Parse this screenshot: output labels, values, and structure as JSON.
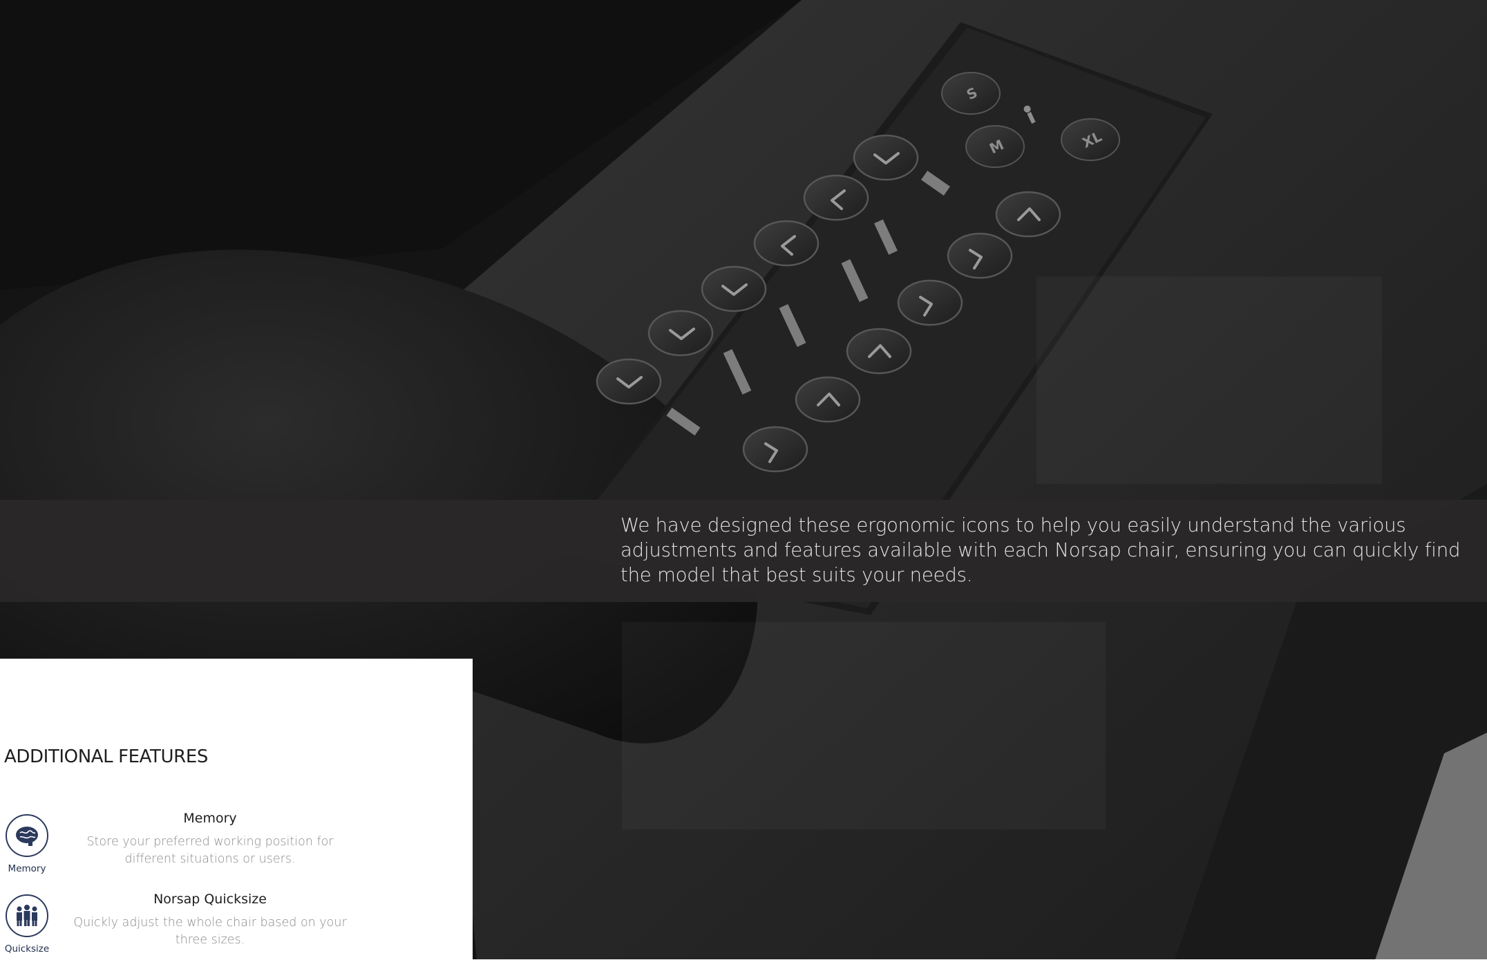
{
  "caption": {
    "text": "We have designed these ergonomic icons to help you easily understand the various adjustments and features available with each Norsap chair, ensuring you can quickly find the model that best suits your needs."
  },
  "features": {
    "title": "ADDITIONAL FEATURES",
    "items": [
      {
        "icon": "brain-icon",
        "icon_label": "Memory",
        "name": "Memory",
        "description": "Store your preferred working position for different situations or users."
      },
      {
        "icon": "three-people-icon",
        "icon_label": "Quicksize",
        "name": "Norsap Quicksize",
        "description": "Quickly adjust the whole chair based on your three sizes."
      }
    ]
  },
  "panel_buttons": {
    "size_labels": [
      "S",
      "M",
      "XL"
    ]
  },
  "colors": {
    "caption_band": "#2a2828",
    "icon_navy": "#2b3a5c",
    "feature_text": "#1e1e1e",
    "feature_desc": "#8a8a8a"
  }
}
